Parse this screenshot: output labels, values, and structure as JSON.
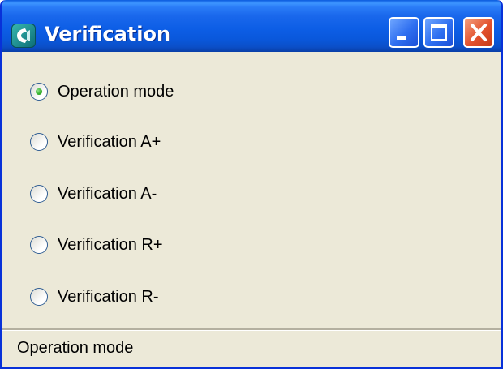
{
  "window": {
    "title": "Verification",
    "icon": "app-logo-icon",
    "controls": [
      "minimize-icon",
      "maximize-icon",
      "close-icon"
    ]
  },
  "options": [
    {
      "label": "Operation mode",
      "checked": true
    },
    {
      "label": "Verification A+",
      "checked": false
    },
    {
      "label": "Verification A-",
      "checked": false
    },
    {
      "label": "Verification R+",
      "checked": false
    },
    {
      "label": "Verification R-",
      "checked": false
    }
  ],
  "statusbar": {
    "text": "Operation mode"
  },
  "colors": {
    "titlebar": "#0a58dc",
    "window_bg": "#ece9d8",
    "close_button": "#e2512d",
    "radio_checked": "#34b22d"
  }
}
